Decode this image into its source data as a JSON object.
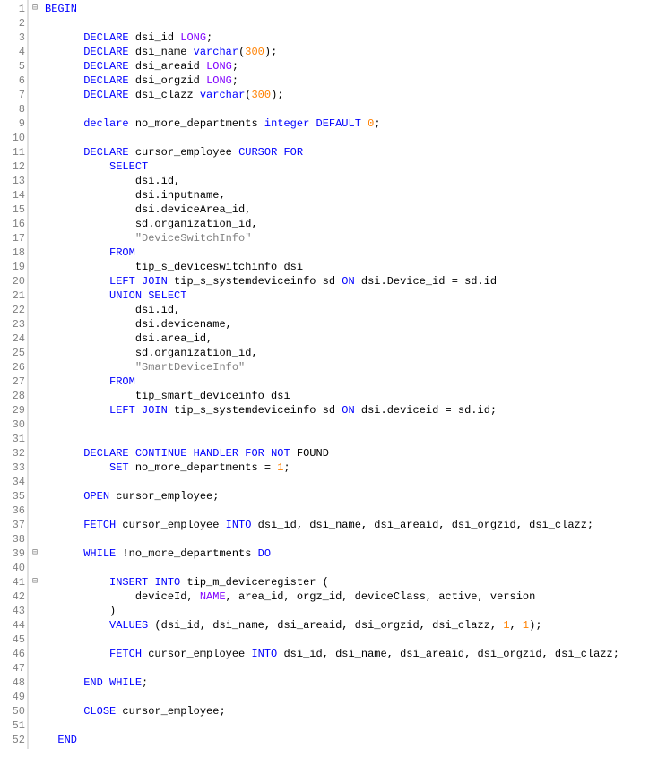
{
  "line_count": 52,
  "fold_marks": {
    "1": "⊟",
    "39": "⊟",
    "41": "⊟"
  },
  "lines": [
    {
      "indent": 0,
      "tokens": [
        {
          "t": "BEGIN",
          "c": "kw"
        }
      ]
    },
    {
      "indent": 0,
      "tokens": []
    },
    {
      "indent": 3,
      "tokens": [
        {
          "t": "DECLARE",
          "c": "kw"
        },
        {
          "t": " dsi_id ",
          "c": "id"
        },
        {
          "t": "LONG",
          "c": "ty"
        },
        {
          "t": ";",
          "c": "punc"
        }
      ]
    },
    {
      "indent": 3,
      "tokens": [
        {
          "t": "DECLARE",
          "c": "kw"
        },
        {
          "t": " dsi_name ",
          "c": "id"
        },
        {
          "t": "varchar",
          "c": "kw"
        },
        {
          "t": "(",
          "c": "punc"
        },
        {
          "t": "300",
          "c": "num"
        },
        {
          "t": ")",
          "c": "punc"
        },
        {
          "t": ";",
          "c": "punc"
        }
      ]
    },
    {
      "indent": 3,
      "tokens": [
        {
          "t": "DECLARE",
          "c": "kw"
        },
        {
          "t": " dsi_areaid ",
          "c": "id"
        },
        {
          "t": "LONG",
          "c": "ty"
        },
        {
          "t": ";",
          "c": "punc"
        }
      ]
    },
    {
      "indent": 3,
      "tokens": [
        {
          "t": "DECLARE",
          "c": "kw"
        },
        {
          "t": " dsi_orgzid ",
          "c": "id"
        },
        {
          "t": "LONG",
          "c": "ty"
        },
        {
          "t": ";",
          "c": "punc"
        }
      ]
    },
    {
      "indent": 3,
      "tokens": [
        {
          "t": "DECLARE",
          "c": "kw"
        },
        {
          "t": " dsi_clazz ",
          "c": "id"
        },
        {
          "t": "varchar",
          "c": "kw"
        },
        {
          "t": "(",
          "c": "punc"
        },
        {
          "t": "300",
          "c": "num"
        },
        {
          "t": ")",
          "c": "punc"
        },
        {
          "t": ";",
          "c": "punc"
        }
      ]
    },
    {
      "indent": 0,
      "tokens": []
    },
    {
      "indent": 3,
      "tokens": [
        {
          "t": "declare",
          "c": "kw"
        },
        {
          "t": " no_more_departments ",
          "c": "id"
        },
        {
          "t": "integer",
          "c": "kw"
        },
        {
          "t": " ",
          "c": "id"
        },
        {
          "t": "DEFAULT",
          "c": "kw"
        },
        {
          "t": " ",
          "c": "id"
        },
        {
          "t": "0",
          "c": "num"
        },
        {
          "t": ";",
          "c": "punc"
        }
      ]
    },
    {
      "indent": 0,
      "tokens": []
    },
    {
      "indent": 3,
      "tokens": [
        {
          "t": "DECLARE",
          "c": "kw"
        },
        {
          "t": " cursor_employee ",
          "c": "id"
        },
        {
          "t": "CURSOR",
          "c": "kw"
        },
        {
          "t": " ",
          "c": "id"
        },
        {
          "t": "FOR",
          "c": "kw"
        }
      ]
    },
    {
      "indent": 5,
      "tokens": [
        {
          "t": "SELECT",
          "c": "kw"
        }
      ]
    },
    {
      "indent": 7,
      "tokens": [
        {
          "t": "dsi.id,",
          "c": "id"
        }
      ]
    },
    {
      "indent": 7,
      "tokens": [
        {
          "t": "dsi.inputname,",
          "c": "id"
        }
      ]
    },
    {
      "indent": 7,
      "tokens": [
        {
          "t": "dsi.deviceArea_id,",
          "c": "id"
        }
      ]
    },
    {
      "indent": 7,
      "tokens": [
        {
          "t": "sd.organization_id,",
          "c": "id"
        }
      ]
    },
    {
      "indent": 7,
      "tokens": [
        {
          "t": "\"DeviceSwitchInfo\"",
          "c": "str"
        }
      ]
    },
    {
      "indent": 5,
      "tokens": [
        {
          "t": "FROM",
          "c": "kw"
        }
      ]
    },
    {
      "indent": 7,
      "tokens": [
        {
          "t": "tip_s_deviceswitchinfo dsi",
          "c": "id"
        }
      ]
    },
    {
      "indent": 5,
      "tokens": [
        {
          "t": "LEFT",
          "c": "kw"
        },
        {
          "t": " ",
          "c": "id"
        },
        {
          "t": "JOIN",
          "c": "kw"
        },
        {
          "t": " tip_s_systemdeviceinfo sd ",
          "c": "id"
        },
        {
          "t": "ON",
          "c": "kw"
        },
        {
          "t": " dsi.Device_id = sd.id",
          "c": "id"
        }
      ]
    },
    {
      "indent": 5,
      "tokens": [
        {
          "t": "UNION",
          "c": "kw"
        },
        {
          "t": " ",
          "c": "id"
        },
        {
          "t": "SELECT",
          "c": "kw"
        }
      ]
    },
    {
      "indent": 7,
      "tokens": [
        {
          "t": "dsi.id,",
          "c": "id"
        }
      ]
    },
    {
      "indent": 7,
      "tokens": [
        {
          "t": "dsi.devicename,",
          "c": "id"
        }
      ]
    },
    {
      "indent": 7,
      "tokens": [
        {
          "t": "dsi.area_id,",
          "c": "id"
        }
      ]
    },
    {
      "indent": 7,
      "tokens": [
        {
          "t": "sd.organization_id,",
          "c": "id"
        }
      ]
    },
    {
      "indent": 7,
      "tokens": [
        {
          "t": "\"SmartDeviceInfo\"",
          "c": "str"
        }
      ]
    },
    {
      "indent": 5,
      "tokens": [
        {
          "t": "FROM",
          "c": "kw"
        }
      ]
    },
    {
      "indent": 7,
      "tokens": [
        {
          "t": "tip_smart_deviceinfo dsi",
          "c": "id"
        }
      ]
    },
    {
      "indent": 5,
      "tokens": [
        {
          "t": "LEFT",
          "c": "kw"
        },
        {
          "t": " ",
          "c": "id"
        },
        {
          "t": "JOIN",
          "c": "kw"
        },
        {
          "t": " tip_s_systemdeviceinfo sd ",
          "c": "id"
        },
        {
          "t": "ON",
          "c": "kw"
        },
        {
          "t": " dsi.deviceid = sd.id;",
          "c": "id"
        }
      ]
    },
    {
      "indent": 0,
      "tokens": []
    },
    {
      "indent": 0,
      "tokens": []
    },
    {
      "indent": 3,
      "tokens": [
        {
          "t": "DECLARE",
          "c": "kw"
        },
        {
          "t": " ",
          "c": "id"
        },
        {
          "t": "CONTINUE",
          "c": "kw"
        },
        {
          "t": " ",
          "c": "id"
        },
        {
          "t": "HANDLER",
          "c": "kw"
        },
        {
          "t": " ",
          "c": "id"
        },
        {
          "t": "FOR",
          "c": "kw"
        },
        {
          "t": " ",
          "c": "id"
        },
        {
          "t": "NOT",
          "c": "kw"
        },
        {
          "t": " FOUND",
          "c": "id"
        }
      ]
    },
    {
      "indent": 5,
      "tokens": [
        {
          "t": "SET",
          "c": "kw"
        },
        {
          "t": " no_more_departments = ",
          "c": "id"
        },
        {
          "t": "1",
          "c": "num"
        },
        {
          "t": ";",
          "c": "punc"
        }
      ]
    },
    {
      "indent": 0,
      "tokens": []
    },
    {
      "indent": 3,
      "tokens": [
        {
          "t": "OPEN",
          "c": "kw"
        },
        {
          "t": " cursor_employee;",
          "c": "id"
        }
      ]
    },
    {
      "indent": 0,
      "tokens": []
    },
    {
      "indent": 3,
      "tokens": [
        {
          "t": "FETCH",
          "c": "kw"
        },
        {
          "t": " cursor_employee ",
          "c": "id"
        },
        {
          "t": "INTO",
          "c": "kw"
        },
        {
          "t": " dsi_id, dsi_name, dsi_areaid, dsi_orgzid, dsi_clazz;",
          "c": "id"
        }
      ]
    },
    {
      "indent": 0,
      "tokens": []
    },
    {
      "indent": 3,
      "tokens": [
        {
          "t": "WHILE",
          "c": "kw"
        },
        {
          "t": " !no_more_departments ",
          "c": "id"
        },
        {
          "t": "DO",
          "c": "kw"
        }
      ]
    },
    {
      "indent": 0,
      "tokens": []
    },
    {
      "indent": 5,
      "tokens": [
        {
          "t": "INSERT",
          "c": "kw"
        },
        {
          "t": " ",
          "c": "id"
        },
        {
          "t": "INTO",
          "c": "kw"
        },
        {
          "t": " tip_m_deviceregister (",
          "c": "id"
        }
      ]
    },
    {
      "indent": 7,
      "tokens": [
        {
          "t": "deviceId, ",
          "c": "id"
        },
        {
          "t": "NAME",
          "c": "ty"
        },
        {
          "t": ", area_id, orgz_id, deviceClass, active, version",
          "c": "id"
        }
      ]
    },
    {
      "indent": 5,
      "tokens": [
        {
          "t": ")",
          "c": "id"
        }
      ]
    },
    {
      "indent": 5,
      "tokens": [
        {
          "t": "VALUES",
          "c": "kw"
        },
        {
          "t": " (dsi_id, dsi_name, dsi_areaid, dsi_orgzid, dsi_clazz, ",
          "c": "id"
        },
        {
          "t": "1",
          "c": "num"
        },
        {
          "t": ", ",
          "c": "id"
        },
        {
          "t": "1",
          "c": "num"
        },
        {
          "t": ");",
          "c": "id"
        }
      ]
    },
    {
      "indent": 0,
      "tokens": []
    },
    {
      "indent": 5,
      "tokens": [
        {
          "t": "FETCH",
          "c": "kw"
        },
        {
          "t": " cursor_employee ",
          "c": "id"
        },
        {
          "t": "INTO",
          "c": "kw"
        },
        {
          "t": " dsi_id, dsi_name, dsi_areaid, dsi_orgzid, dsi_clazz;",
          "c": "id"
        }
      ]
    },
    {
      "indent": 0,
      "tokens": []
    },
    {
      "indent": 3,
      "tokens": [
        {
          "t": "END",
          "c": "kw"
        },
        {
          "t": " ",
          "c": "id"
        },
        {
          "t": "WHILE",
          "c": "kw"
        },
        {
          "t": ";",
          "c": "punc"
        }
      ]
    },
    {
      "indent": 0,
      "tokens": []
    },
    {
      "indent": 3,
      "tokens": [
        {
          "t": "CLOSE",
          "c": "kw"
        },
        {
          "t": " cursor_employee;",
          "c": "id"
        }
      ]
    },
    {
      "indent": 0,
      "tokens": []
    },
    {
      "indent": 1,
      "tokens": [
        {
          "t": "END",
          "c": "kw"
        }
      ]
    }
  ]
}
